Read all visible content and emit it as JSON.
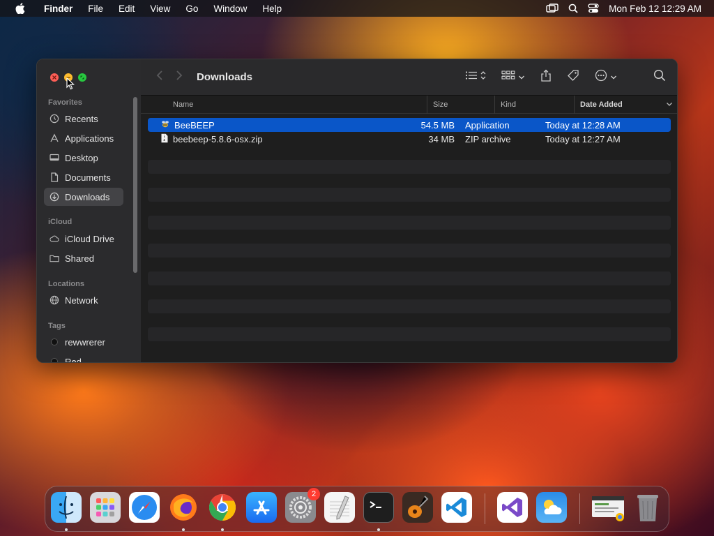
{
  "menubar": {
    "app_name": "Finder",
    "items": [
      "File",
      "Edit",
      "View",
      "Go",
      "Window",
      "Help"
    ],
    "clock": "Mon Feb 12  12:29 AM"
  },
  "window": {
    "title": "Downloads",
    "sidebar": {
      "sections": {
        "favorites": "Favorites",
        "icloud": "iCloud",
        "locations": "Locations",
        "tags": "Tags"
      },
      "favorites": [
        {
          "label": "Recents",
          "icon": "clock-icon"
        },
        {
          "label": "Applications",
          "icon": "applications-icon"
        },
        {
          "label": "Desktop",
          "icon": "desktop-icon"
        },
        {
          "label": "Documents",
          "icon": "document-icon"
        },
        {
          "label": "Downloads",
          "icon": "download-icon",
          "active": true
        }
      ],
      "icloud": [
        {
          "label": "iCloud Drive",
          "icon": "cloud-icon"
        },
        {
          "label": "Shared",
          "icon": "shared-folder-icon"
        }
      ],
      "locations": [
        {
          "label": "Network",
          "icon": "globe-icon"
        }
      ],
      "tags": [
        {
          "label": "rewwrerer"
        },
        {
          "label": "Red"
        }
      ]
    },
    "columns": {
      "name": "Name",
      "size": "Size",
      "kind": "Kind",
      "date": "Date Added"
    },
    "files": [
      {
        "name": "BeeBEEP",
        "size": "54.5 MB",
        "kind": "Application",
        "date": "Today at 12:28 AM",
        "selected": true
      },
      {
        "name": "beebeep-5.8.6-osx.zip",
        "size": "34 MB",
        "kind": "ZIP archive",
        "date": "Today at 12:27 AM"
      }
    ]
  },
  "dock": {
    "apps": [
      "Finder",
      "Launchpad",
      "Safari",
      "Firefox",
      "Chrome",
      "App Store",
      "System Settings",
      "TextEdit",
      "Terminal",
      "GarageBand",
      "VS Code",
      "Visual Studio",
      "Weather",
      "Chrome App",
      "Trash"
    ],
    "settings_badge": "2"
  },
  "colors": {
    "selection": "#0a56c8",
    "red_light": "#ff5f57",
    "yellow_light": "#febc2e",
    "green_light": "#28c840"
  }
}
